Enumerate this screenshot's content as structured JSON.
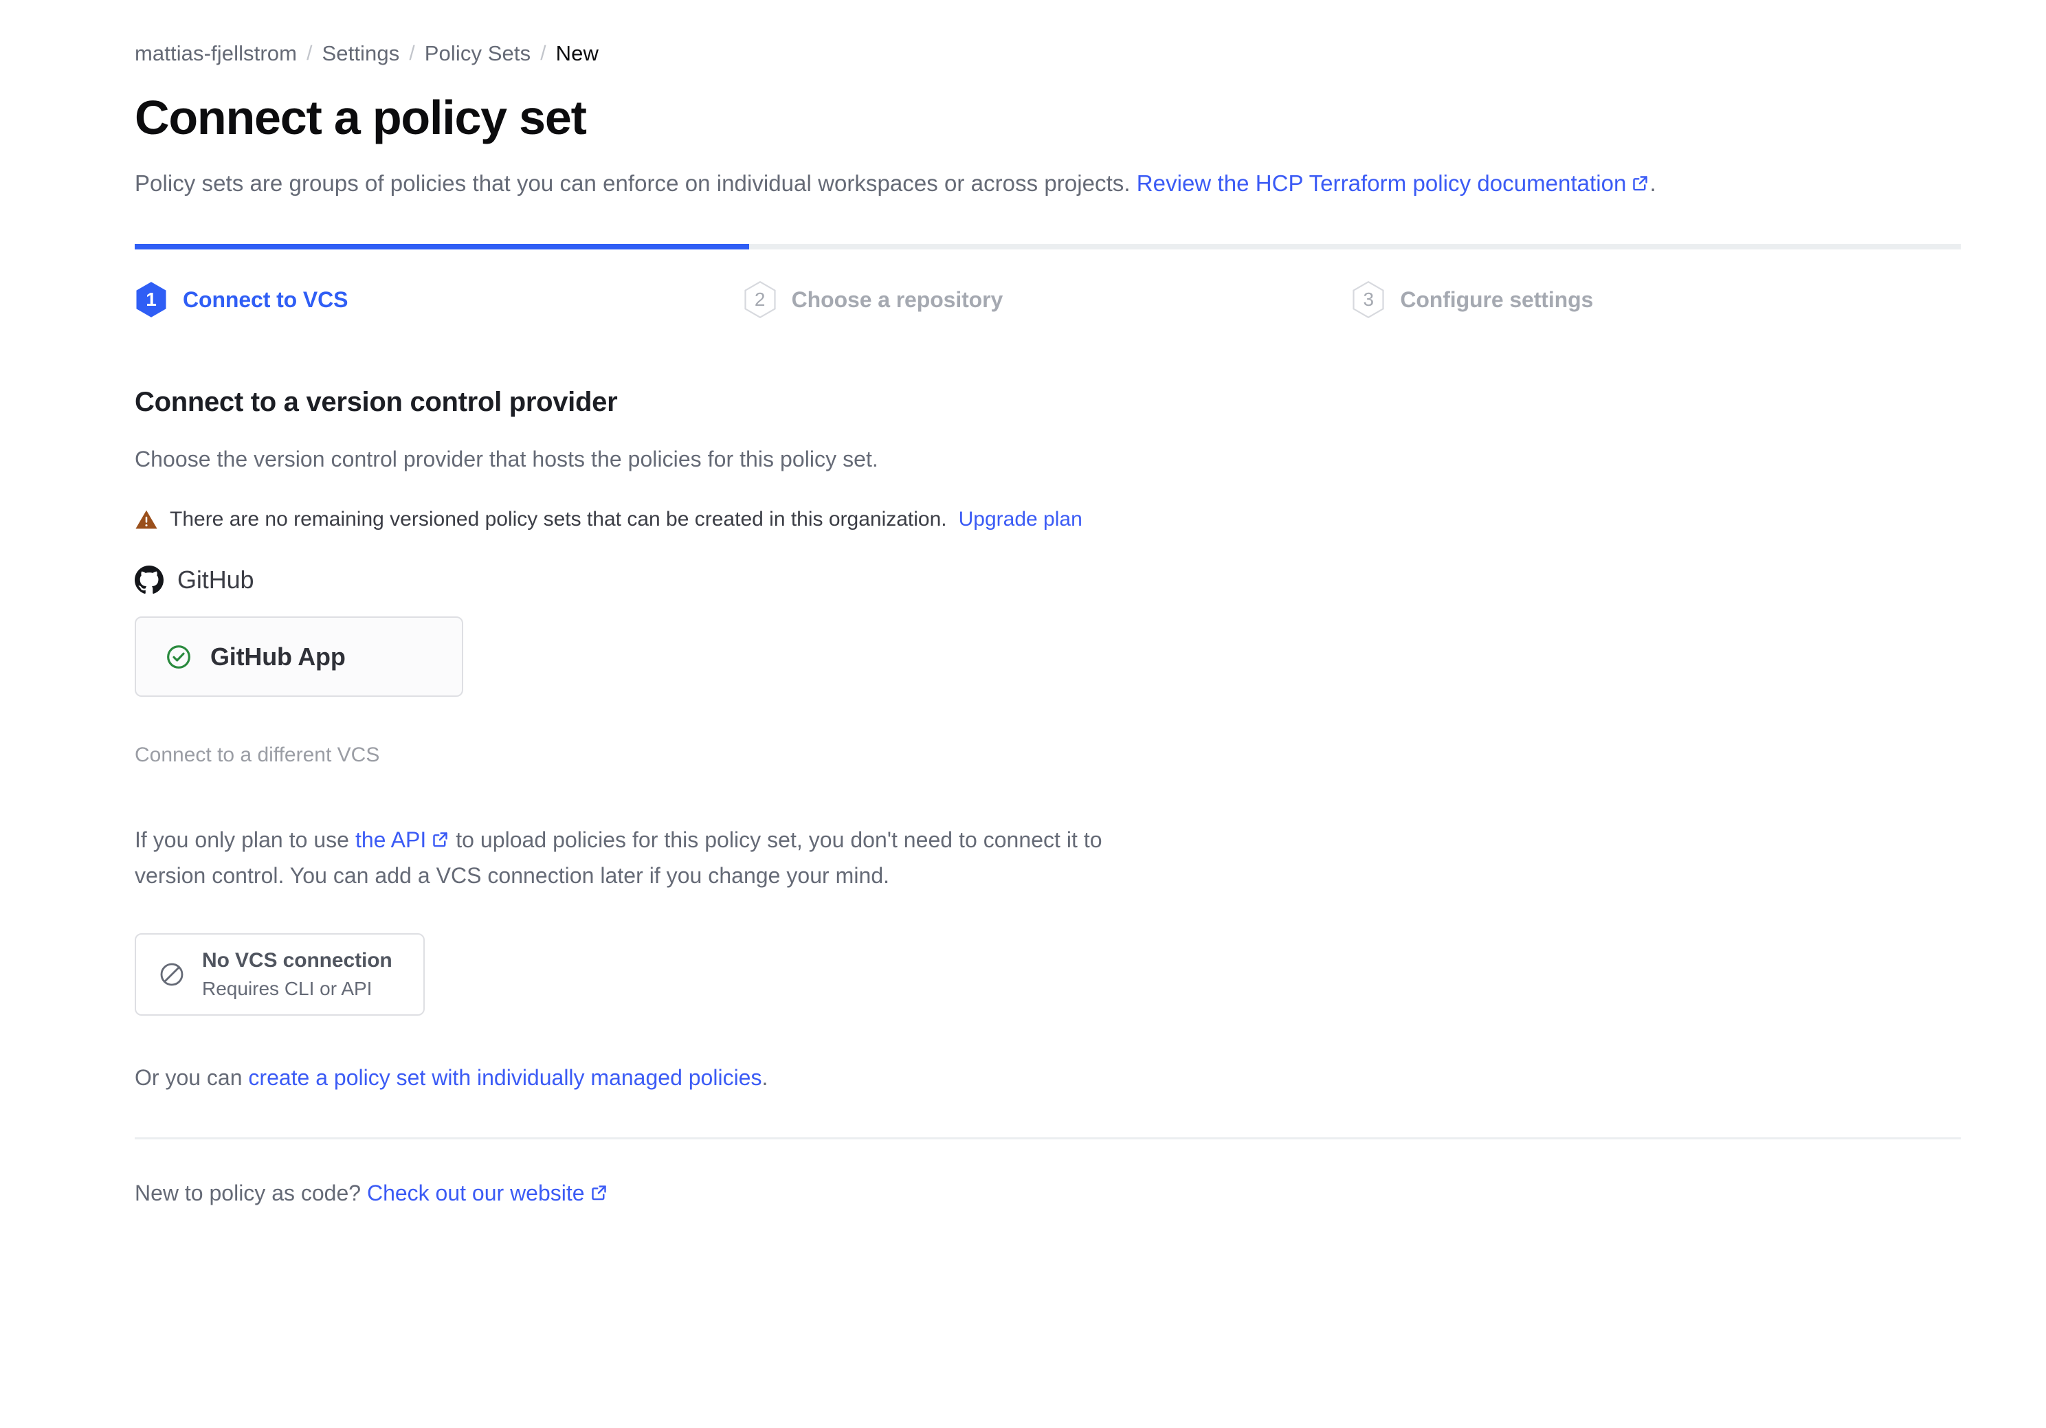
{
  "breadcrumb": {
    "items": [
      {
        "label": "mattias-fjellstrom",
        "current": false
      },
      {
        "label": "Settings",
        "current": false
      },
      {
        "label": "Policy Sets",
        "current": false
      },
      {
        "label": "New",
        "current": true
      }
    ],
    "separator": "/"
  },
  "header": {
    "title": "Connect a policy set",
    "subtitle_before": "Policy sets are groups of policies that you can enforce on individual workspaces or across projects. ",
    "subtitle_link": "Review the HCP Terraform policy documentation",
    "subtitle_after": "."
  },
  "stepper": {
    "active_index": 1,
    "steps": [
      {
        "number": "1",
        "label": "Connect to VCS",
        "state": "active"
      },
      {
        "number": "2",
        "label": "Choose a repository",
        "state": "inactive"
      },
      {
        "number": "3",
        "label": "Configure settings",
        "state": "inactive"
      }
    ]
  },
  "main": {
    "heading": "Connect to a version control provider",
    "subheading": "Choose the version control provider that hosts the policies for this policy set.",
    "alert": {
      "icon": "warning-triangle-icon",
      "text": "There are no remaining versioned policy sets that can be created in this organization. ",
      "link": "Upgrade plan"
    },
    "provider": {
      "icon": "github-icon",
      "name": "GitHub",
      "option": {
        "icon": "check-circle-icon",
        "label": "GitHub App"
      }
    },
    "different_vcs_label": "Connect to a different VCS",
    "api_paragraph": {
      "before": "If you only plan to use ",
      "link": "the API",
      "after": " to upload policies for this policy set, you don't need to connect it to version control. You can add a VCS connection later if you change your mind."
    },
    "no_vcs_card": {
      "icon": "no-entry-icon",
      "title": "No VCS connection",
      "subtitle": "Requires CLI or API"
    },
    "individually_managed": {
      "before": "Or you can ",
      "link": "create a policy set with individually managed policies",
      "after": "."
    }
  },
  "footer": {
    "before": "New to policy as code? ",
    "link": "Check out our website"
  },
  "colors": {
    "accent_blue": "#2f5ef5",
    "link_blue": "#3b5bf5",
    "warning_brown": "#9a4f1b",
    "success_green": "#2a8a3e",
    "muted_text": "#656a76",
    "heading_text": "#0c0c0e",
    "border_grey": "#dedfe3",
    "track_grey": "#ebeef0"
  }
}
